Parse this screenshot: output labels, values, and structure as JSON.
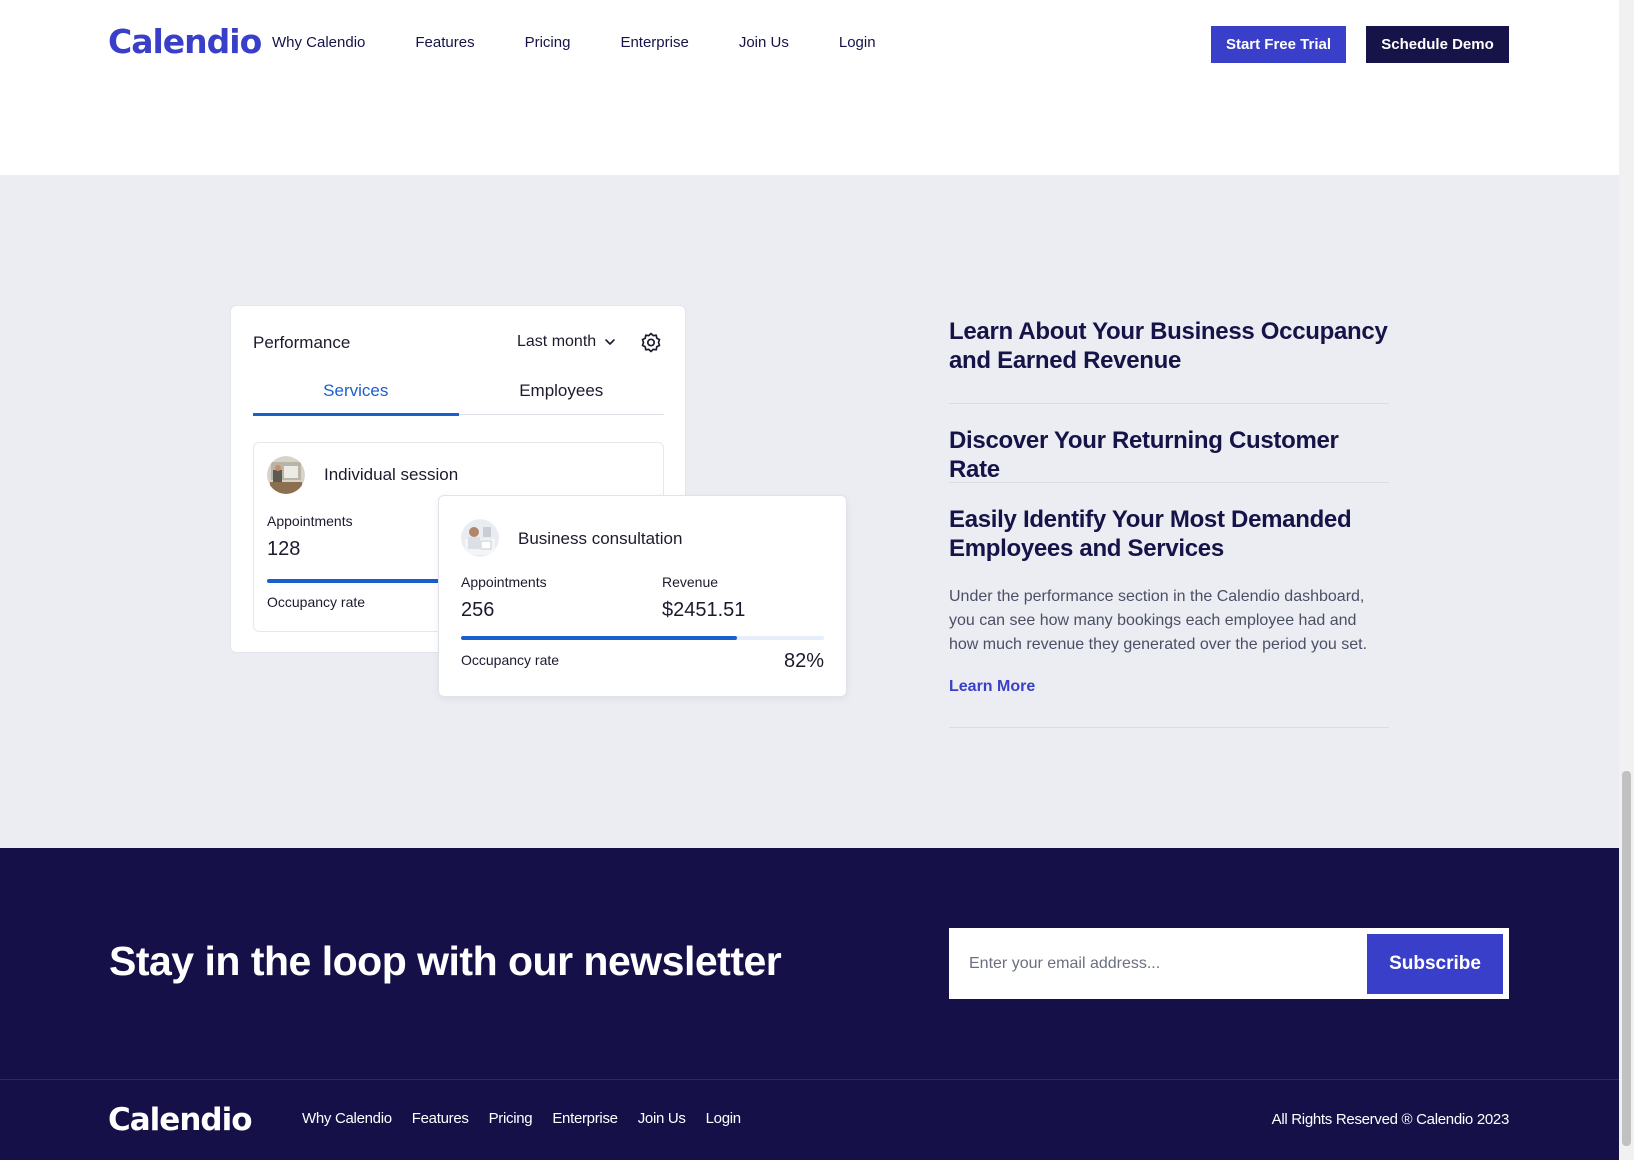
{
  "header": {
    "logo": "Calendio",
    "nav": [
      "Why Calendio",
      "Features",
      "Pricing",
      "Enterprise",
      "Join Us",
      "Login"
    ],
    "start_trial": "Start Free Trial",
    "schedule_demo": "Schedule Demo"
  },
  "performance": {
    "title": "Performance",
    "period": "Last month",
    "tabs": [
      "Services",
      "Employees"
    ],
    "active_tab": "Services",
    "individual": {
      "name": "Individual session",
      "appointments_label": "Appointments",
      "appointments": "128",
      "occupancy_label": "Occupancy rate"
    },
    "business": {
      "name": "Business consultation",
      "appointments_label": "Appointments",
      "appointments": "256",
      "revenue_label": "Revenue",
      "revenue": "$2451.51",
      "occupancy_label": "Occupancy rate",
      "occupancy": "82%",
      "occupancy_fraction": 0.76
    }
  },
  "features": {
    "item1": "Learn About Your Business Occupancy and Earned Revenue",
    "item2": "Discover Your Returning Customer Rate",
    "item3": "Easily Identify Your Most Demanded Employees and Services",
    "desc": "Under the performance section in the Calendio dashboard, you can see how many bookings each employee had and how much revenue they generated over the period you set.",
    "learn_more": "Learn More"
  },
  "newsletter": {
    "title": "Stay in the loop with our newsletter",
    "placeholder": "Enter your email address...",
    "subscribe": "Subscribe"
  },
  "footer": {
    "logo": "Calendio",
    "nav": [
      "Why Calendio",
      "Features",
      "Pricing",
      "Enterprise",
      "Join Us",
      "Login"
    ],
    "copyright": "All Rights Reserved ® Calendio 2023"
  },
  "colors": {
    "brand": "#3a3fc9",
    "navy": "#151048",
    "accent_blue": "#1a5fd0"
  }
}
